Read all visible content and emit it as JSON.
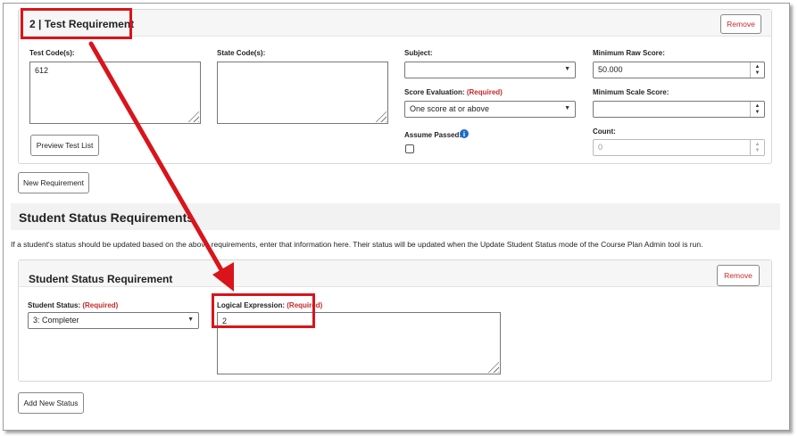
{
  "test_requirement": {
    "title": "2 | Test Requirement",
    "remove_label": "Remove",
    "test_codes_label": "Test Code(s):",
    "test_codes_value": "612",
    "state_codes_label": "State Code(s):",
    "state_codes_value": "",
    "subject_label": "Subject:",
    "subject_value": "",
    "score_eval_label": "Score Evaluation:",
    "required": "(Required)",
    "score_eval_value": "One score at or above",
    "assume_passed_label": "Assume Passed:",
    "min_raw_label": "Minimum Raw Score:",
    "min_raw_value": "50.000",
    "min_scale_label": "Minimum Scale Score:",
    "min_scale_value": "",
    "count_label": "Count:",
    "count_value": "0",
    "preview_label": "Preview Test List"
  },
  "new_requirement_label": "New Requirement",
  "student_status_section": {
    "title": "Student Status Requirements",
    "help_text": "If a student's status should be updated based on the above requirements, enter that information here. Their status will be updated when the Update Student Status mode of the Course Plan Admin tool is run."
  },
  "student_status_requirement": {
    "title": "Student Status Requirement",
    "remove_label": "Remove",
    "status_label": "Student Status:",
    "required": "(Required)",
    "status_value": "3: Completer",
    "logical_label": "Logical Expression:",
    "logical_value": "2"
  },
  "add_status_label": "Add New Status",
  "colors": {
    "highlight": "#d9141b",
    "required": "#c62828",
    "info": "#1e6cc8"
  }
}
